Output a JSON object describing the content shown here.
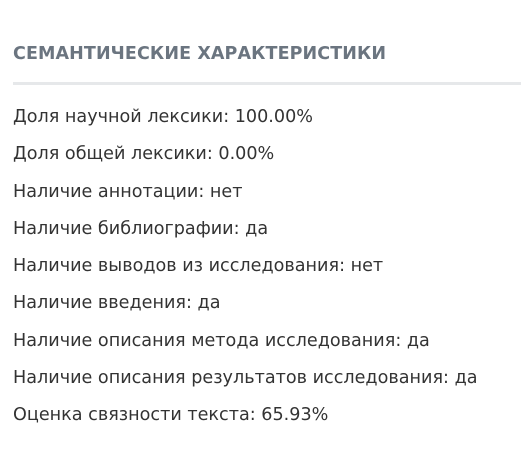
{
  "section": {
    "title": "СЕМАНТИЧЕСКИЕ ХАРАКТЕРИСТИКИ"
  },
  "characteristics": [
    {
      "label": "Доля научной лексики",
      "value": "100.00%"
    },
    {
      "label": "Доля общей лексики",
      "value": "0.00%"
    },
    {
      "label": "Наличие аннотации",
      "value": "нет"
    },
    {
      "label": "Наличие библиографии",
      "value": "да"
    },
    {
      "label": "Наличие выводов из исследования",
      "value": "нет"
    },
    {
      "label": "Наличие введения",
      "value": "да"
    },
    {
      "label": "Наличие описания метода исследования",
      "value": "да"
    },
    {
      "label": "Наличие описания результатов исследования",
      "value": "да"
    },
    {
      "label": "Оценка связности текста",
      "value": "65.93%"
    }
  ],
  "colors": {
    "title": "#6b7580",
    "text": "#333333",
    "divider": "#e6e8ea",
    "background": "#ffffff"
  }
}
